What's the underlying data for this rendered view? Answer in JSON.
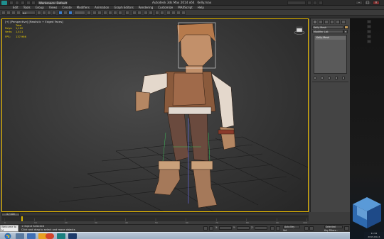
{
  "window": {
    "workspace": "Workspace: Default",
    "title": "Autodesk 3ds Max 2014 x64",
    "filename": "Kelly.max",
    "search_placeholder": "",
    "minimize": "–",
    "maximize": "□",
    "close": "×"
  },
  "menu": [
    "Edit",
    "Tools",
    "Group",
    "Views",
    "Create",
    "Modifiers",
    "Animation",
    "Graph Editors",
    "Rendering",
    "Customize",
    "MAXScript",
    "Help"
  ],
  "toolbar": {
    "selection_filter": "All"
  },
  "viewport": {
    "label": "[+] [Perspective] [Realistic + Edged Faces]",
    "stats": [
      {
        "key": "",
        "value": "Total"
      },
      {
        "key": "Polys:",
        "value": "1,102"
      },
      {
        "key": "Verts:",
        "value": "1,411"
      },
      {
        "key": "",
        "value": ""
      },
      {
        "key": "FPS:",
        "value": "137.966"
      }
    ]
  },
  "command_panel": {
    "object_name": "Kelly-Mesh",
    "modifier_list": "Modifier List",
    "dropdown_arrow": "▾",
    "stack_item": "Kelly-Mesh"
  },
  "timeline": {
    "thumb": "0 / 100",
    "ticks": [
      "0",
      "10",
      "20",
      "30",
      "40",
      "50",
      "60",
      "70",
      "80",
      "90",
      "100"
    ]
  },
  "status": {
    "listener": "Welcome to M",
    "selected": "1 Object Selected",
    "prompt": "Click and drag to select and move objects",
    "x_label": "X:",
    "y_label": "Y:",
    "z_label": "Z:",
    "x": "",
    "y": "",
    "z": "",
    "auto_key": "Auto Key",
    "selected_dd": "Selected",
    "set_key": "Set Key",
    "key_filters": "Key Filters..."
  },
  "clock": {
    "time": "11:52",
    "date": "2013-04-11"
  },
  "colors": {
    "accent": "#3d7cc9",
    "viewport_border": "#f0c000",
    "object_color": "#c29a57"
  }
}
